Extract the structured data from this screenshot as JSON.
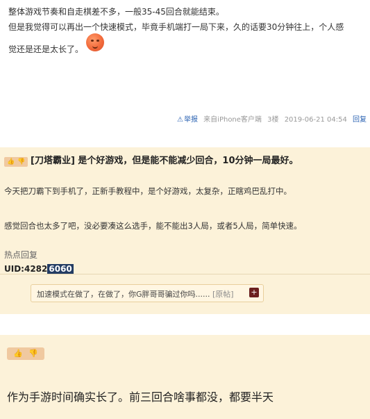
{
  "post1": {
    "line1": "整体游戏节奏和自走棋差不多，一般35-45回合就能结束。",
    "line2": "但是我觉得可以再出一个快速模式，毕竟手机端打一局下来，久的话要30分钟往上，个人感",
    "line3": "觉还是还是太长了。",
    "meta": {
      "report_icon": "⚠",
      "report": "举报",
      "source": "来自iPhone客户端",
      "floor": "3楼",
      "time": "2019-06-21 04:54",
      "reply": "回复"
    }
  },
  "card2": {
    "title": "[刀塔霸业] 是个好游戏，但是能不能减少回合，10分钟一局最好。",
    "line1": "今天把刀霸下到手机了，正新手教程中，是个好游戏，太复杂，正瞎鸡巴乱打中。",
    "line2": "感觉回合也太多了吧，没必要凑这么选手，能不能出3人局，或者5人局，简单快速。",
    "hot_reply_label": "热点回复",
    "uid_prefix": "UID:4282",
    "uid_highlight": "6060",
    "reply_text": "加速模式在做了，在做了，你G胖哥哥骗过你吗......",
    "reply_link": "[原帖]",
    "reply_plus": "+"
  },
  "card3": {
    "text": "作为手游时间确实长了。前三回合啥事都没，都要半天"
  },
  "icons": {
    "thumb_up": "👍",
    "thumb_down": "👎"
  }
}
